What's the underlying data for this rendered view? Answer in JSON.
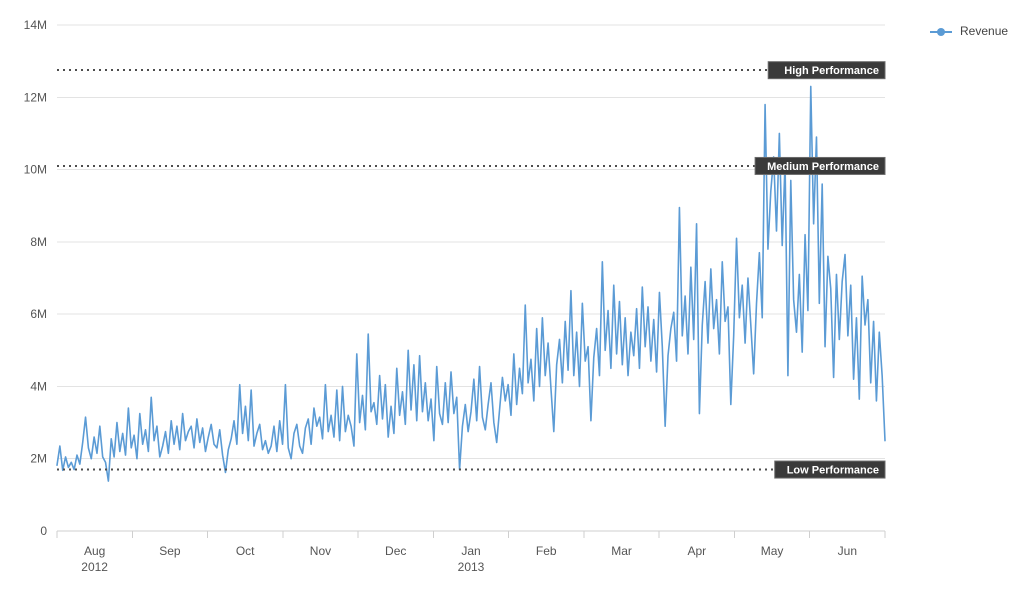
{
  "chart_data": {
    "type": "line",
    "title": "",
    "subtitle": "",
    "xlabel": "",
    "ylabel": "",
    "grid": true,
    "ylim": [
      0,
      14000000
    ],
    "y_ticks": [
      0,
      2000000,
      4000000,
      6000000,
      8000000,
      10000000,
      12000000,
      14000000
    ],
    "y_tick_labels": [
      "0",
      "2M",
      "4M",
      "6M",
      "8M",
      "10M",
      "12M",
      "14M"
    ],
    "x_ticks": [
      {
        "label": "Aug",
        "year": "2012"
      },
      {
        "label": "Sep",
        "year": ""
      },
      {
        "label": "Oct",
        "year": ""
      },
      {
        "label": "Nov",
        "year": ""
      },
      {
        "label": "Dec",
        "year": ""
      },
      {
        "label": "Jan",
        "year": "2013"
      },
      {
        "label": "Feb",
        "year": ""
      },
      {
        "label": "Mar",
        "year": ""
      },
      {
        "label": "Apr",
        "year": ""
      },
      {
        "label": "May",
        "year": ""
      },
      {
        "label": "Jun",
        "year": ""
      }
    ],
    "legend": {
      "position": "top-right",
      "entries": [
        {
          "name": "Revenue",
          "color": "#5b9bd5",
          "marker": "circle"
        }
      ]
    },
    "reference_lines": [
      {
        "label": "High Performance",
        "value": 12750000,
        "style": "dotted",
        "color": "#4d4d4d"
      },
      {
        "label": "Medium Performance",
        "value": 10100000,
        "style": "dotted",
        "color": "#4d4d4d"
      },
      {
        "label": "Low Performance",
        "value": 1700000,
        "style": "dotted",
        "color": "#4d4d4d"
      }
    ],
    "series": [
      {
        "name": "Revenue",
        "color": "#5b9bd5",
        "values": [
          1820000,
          2350000,
          1680000,
          2050000,
          1760000,
          1900000,
          1700000,
          2100000,
          1850000,
          2450000,
          3150000,
          2300000,
          2000000,
          2600000,
          2150000,
          2900000,
          2050000,
          1900000,
          1380000,
          2550000,
          2050000,
          3000000,
          2200000,
          2700000,
          2100000,
          3400000,
          2300000,
          2650000,
          2000000,
          3250000,
          2400000,
          2800000,
          2200000,
          3700000,
          2500000,
          2900000,
          2050000,
          2350000,
          2750000,
          2150000,
          3050000,
          2400000,
          2900000,
          2250000,
          3250000,
          2500000,
          2750000,
          2900000,
          2300000,
          3100000,
          2450000,
          2850000,
          2200000,
          2600000,
          2950000,
          2400000,
          2300000,
          2800000,
          2100000,
          1620000,
          2250000,
          2550000,
          3050000,
          2400000,
          4050000,
          2700000,
          3450000,
          2500000,
          3900000,
          2350000,
          2700000,
          2950000,
          2250000,
          2500000,
          2150000,
          2350000,
          2900000,
          2200000,
          3050000,
          2400000,
          4050000,
          2300000,
          2000000,
          2700000,
          2950000,
          2350000,
          2150000,
          2850000,
          3100000,
          2400000,
          3400000,
          2900000,
          3150000,
          2550000,
          4050000,
          2750000,
          3200000,
          2600000,
          3900000,
          2500000,
          4000000,
          2750000,
          3200000,
          2900000,
          2350000,
          4900000,
          3000000,
          3750000,
          2800000,
          5450000,
          3300000,
          3550000,
          2950000,
          4300000,
          3100000,
          4050000,
          2600000,
          3450000,
          2700000,
          4500000,
          3200000,
          3850000,
          2950000,
          5000000,
          3350000,
          4600000,
          3050000,
          4850000,
          3300000,
          4100000,
          3050000,
          3650000,
          2500000,
          4550000,
          3250000,
          2950000,
          4100000,
          3000000,
          4400000,
          3250000,
          3700000,
          1700000,
          2900000,
          3500000,
          2750000,
          3300000,
          4200000,
          3050000,
          4550000,
          3150000,
          2800000,
          3500000,
          4100000,
          3000000,
          2450000,
          3350000,
          4250000,
          3600000,
          4050000,
          3200000,
          4900000,
          3500000,
          4500000,
          3800000,
          6250000,
          4100000,
          4750000,
          3600000,
          5600000,
          4000000,
          5900000,
          4300000,
          5200000,
          3950000,
          2750000,
          4600000,
          5300000,
          4100000,
          5800000,
          4450000,
          6650000,
          4300000,
          5500000,
          4000000,
          6300000,
          4700000,
          5100000,
          3050000,
          4800000,
          5600000,
          4300000,
          7450000,
          5000000,
          6100000,
          4500000,
          6800000,
          4900000,
          6350000,
          4600000,
          5900000,
          4300000,
          5500000,
          4850000,
          6150000,
          4500000,
          6750000,
          5100000,
          6200000,
          4700000,
          5850000,
          4400000,
          6600000,
          5100000,
          2900000,
          4850000,
          5600000,
          6050000,
          4700000,
          8950000,
          5400000,
          6500000,
          4900000,
          7300000,
          5300000,
          8500000,
          3250000,
          5700000,
          6900000,
          5200000,
          7250000,
          5600000,
          6400000,
          4900000,
          7450000,
          5800000,
          6200000,
          3500000,
          5400000,
          8100000,
          5900000,
          6800000,
          5200000,
          7000000,
          5700000,
          4350000,
          6300000,
          7700000,
          5900000,
          11800000,
          7800000,
          9400000,
          10350000,
          8300000,
          11000000,
          7900000,
          10200000,
          4300000,
          9700000,
          6400000,
          5500000,
          7100000,
          4950000,
          8200000,
          6100000,
          12300000,
          8500000,
          10900000,
          6300000,
          9600000,
          5100000,
          7600000,
          6700000,
          4250000,
          7100000,
          5300000,
          6900000,
          7650000,
          5400000,
          6800000,
          4200000,
          5900000,
          3650000,
          7050000,
          5700000,
          6400000,
          4100000,
          5800000,
          3600000,
          5500000,
          4300000,
          2500000
        ]
      }
    ]
  },
  "legend": {
    "entries": [
      {
        "label": "Revenue",
        "color": "#5b9bd5"
      }
    ]
  },
  "annotations": {
    "high": "High Performance",
    "medium": "Medium Performance",
    "low": "Low Performance"
  },
  "axis": {
    "y_labels": [
      "14M",
      "12M",
      "10M",
      "8M",
      "6M",
      "4M",
      "2M",
      "0"
    ],
    "x_labels": [
      "Aug",
      "Sep",
      "Oct",
      "Nov",
      "Dec",
      "Jan",
      "Feb",
      "Mar",
      "Apr",
      "May",
      "Jun"
    ],
    "x_years": [
      "2012",
      "",
      "",
      "",
      "",
      "2013",
      "",
      "",
      "",
      "",
      ""
    ]
  },
  "colors": {
    "series": "#5b9bd5",
    "grid": "#e3e3e3",
    "axis": "#cfcfcf",
    "reference": "#4d4d4d",
    "annotation_bg": "#3a3a3a",
    "annotation_text": "#ffffff",
    "tick_text": "#555555"
  }
}
